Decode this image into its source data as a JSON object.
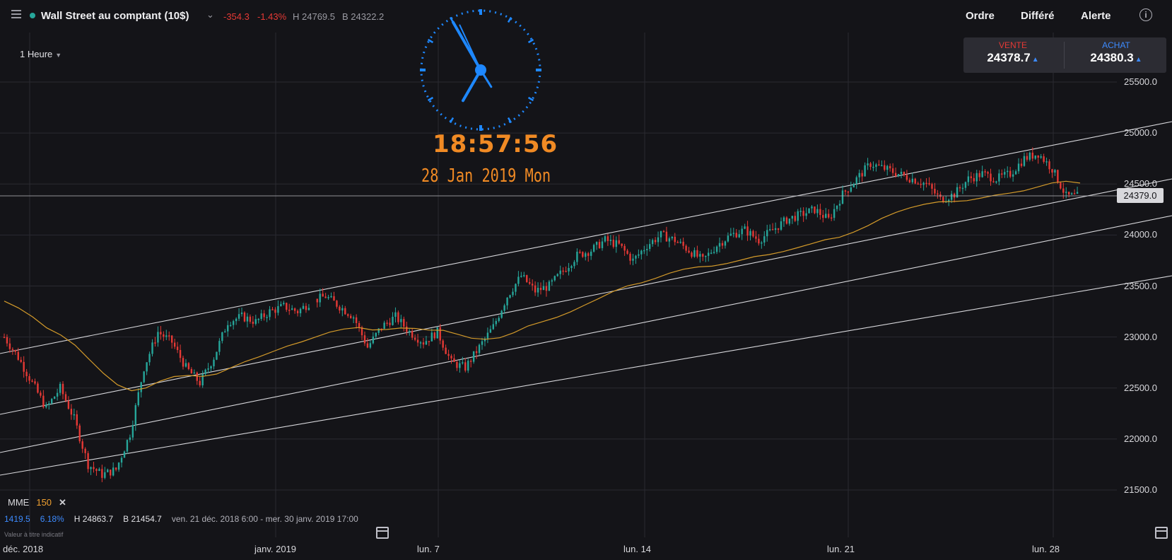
{
  "header": {
    "instrument": "Wall Street au comptant (10$)",
    "change_abs": "-354.3",
    "change_pct": "-1.43%",
    "high": "H 24769.5",
    "bid": "B 24322.2",
    "buttons": [
      "Ordre",
      "Différé",
      "Alerte"
    ]
  },
  "timeframe": "1 Heure",
  "trade": {
    "sell_label": "VENTE",
    "sell_price": "24378.7",
    "buy_label": "ACHAT",
    "buy_price": "24380.3",
    "sell_color": "#e53935",
    "buy_color": "#3d8bff"
  },
  "clock": {
    "time": "18:57:56",
    "date": "28 Jan 2019 Mon"
  },
  "indicator": {
    "name": "MME",
    "period": "150"
  },
  "stats": {
    "range": "1419.5",
    "range_pct": "6.18%",
    "high": "H 24863.7",
    "low": "B 21454.7",
    "period": "ven. 21 déc. 2018 6:00 - mer. 30 janv. 2019 17:00"
  },
  "disclaimer": "Valeur à titre indicatif",
  "current_price": "24379.0",
  "chart_data": {
    "type": "candlestick",
    "x_labels": [
      "déc. 2018",
      "janv. 2019",
      "lun. 7",
      "lun. 14",
      "lun. 21",
      "lun. 28"
    ],
    "y_ticks": [
      "25500.0",
      "25000.0",
      "24500.0",
      "24000.0",
      "23500.0",
      "23000.0",
      "22500.0",
      "22000.0",
      "21500.0"
    ],
    "ylim": [
      21150,
      25700
    ],
    "series": [
      {
        "name": "MME 150",
        "type": "line",
        "color": "#d39a2a"
      }
    ],
    "up_color": "#26a69a",
    "down_color": "#e53935",
    "close_series": [
      23000,
      22800,
      22550,
      22300,
      22500,
      22200,
      21750,
      21650,
      21700,
      22050,
      22700,
      23050,
      22950,
      22700,
      22550,
      22800,
      23150,
      23200,
      23150,
      23250,
      23300,
      23250,
      23350,
      23400,
      23300,
      23200,
      22900,
      23100,
      23200,
      23050,
      22950,
      23050,
      22750,
      22700,
      22900,
      23100,
      23400,
      23600,
      23450,
      23500,
      23650,
      23800,
      23850,
      23950,
      23900,
      23750,
      23900,
      24000,
      23950,
      23850,
      23750,
      23900,
      24000,
      24050,
      23950,
      24050,
      24150,
      24200,
      24250,
      24150,
      24400,
      24550,
      24700,
      24650,
      24600,
      24550,
      24500,
      24350,
      24400,
      24550,
      24600,
      24550,
      24600,
      24750,
      24800,
      24650,
      24380
    ],
    "trend_channel": true
  }
}
